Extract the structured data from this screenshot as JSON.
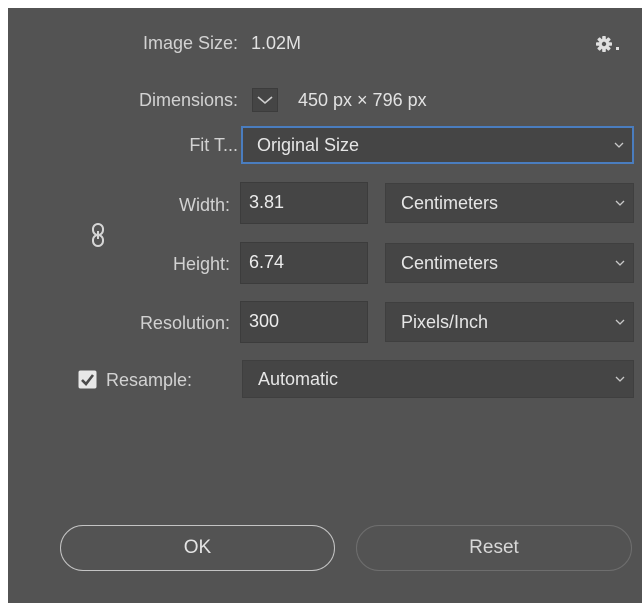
{
  "image_size": {
    "label": "Image Size:",
    "value": "1.02M"
  },
  "settings_menu": {
    "icon": "gear-icon"
  },
  "dimensions": {
    "label": "Dimensions:",
    "value": "450 px  ×  796 px"
  },
  "fit_to": {
    "label": "Fit T...",
    "selected": "Original Size"
  },
  "width": {
    "label": "Width:",
    "value": "3.81",
    "unit": "Centimeters"
  },
  "height": {
    "label": "Height:",
    "value": "6.74",
    "unit": "Centimeters"
  },
  "constrain": {
    "icon": "link-icon"
  },
  "resolution": {
    "label": "Resolution:",
    "value": "300",
    "unit": "Pixels/Inch"
  },
  "resample": {
    "label": "Resample:",
    "checked": true,
    "selected": "Automatic"
  },
  "buttons": {
    "ok": "OK",
    "reset": "Reset"
  },
  "colors": {
    "dialog_bg": "#535353",
    "field_bg": "#454545",
    "focus_border": "#4a7dbf",
    "text": "#d2d2d2"
  }
}
